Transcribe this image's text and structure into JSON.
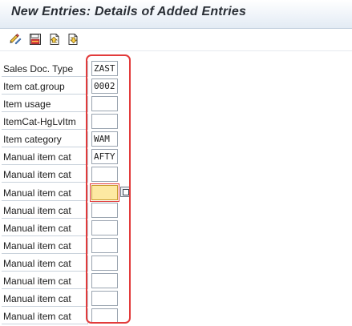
{
  "header": {
    "title": "New Entries: Details of Added Entries"
  },
  "toolbar": {
    "buttons": [
      {
        "name": "display-change-icon"
      },
      {
        "name": "save-icon"
      },
      {
        "name": "previous-entry-icon"
      },
      {
        "name": "next-entry-icon"
      }
    ]
  },
  "form": {
    "rows": [
      {
        "label": "Sales Doc. Type",
        "value": "ZAST"
      },
      {
        "label": "Item cat.group",
        "value": "0002"
      },
      {
        "label": "Item usage",
        "value": ""
      },
      {
        "label": "ItemCat-HgLvItm",
        "value": ""
      },
      {
        "label": "Item category",
        "value": "WAM"
      },
      {
        "label": "Manual item cat",
        "value": "AFTY"
      },
      {
        "label": "Manual item cat",
        "value": ""
      },
      {
        "label": "Manual item cat",
        "value": "",
        "focused": true
      },
      {
        "label": "Manual item cat",
        "value": ""
      },
      {
        "label": "Manual item cat",
        "value": ""
      },
      {
        "label": "Manual item cat",
        "value": ""
      },
      {
        "label": "Manual item cat",
        "value": ""
      },
      {
        "label": "Manual item cat",
        "value": ""
      },
      {
        "label": "Manual item cat",
        "value": ""
      },
      {
        "label": "Manual item cat",
        "value": ""
      }
    ]
  },
  "colors": {
    "focused_field_bg": "#fde9a2",
    "highlight_border": "#e23b3b"
  }
}
